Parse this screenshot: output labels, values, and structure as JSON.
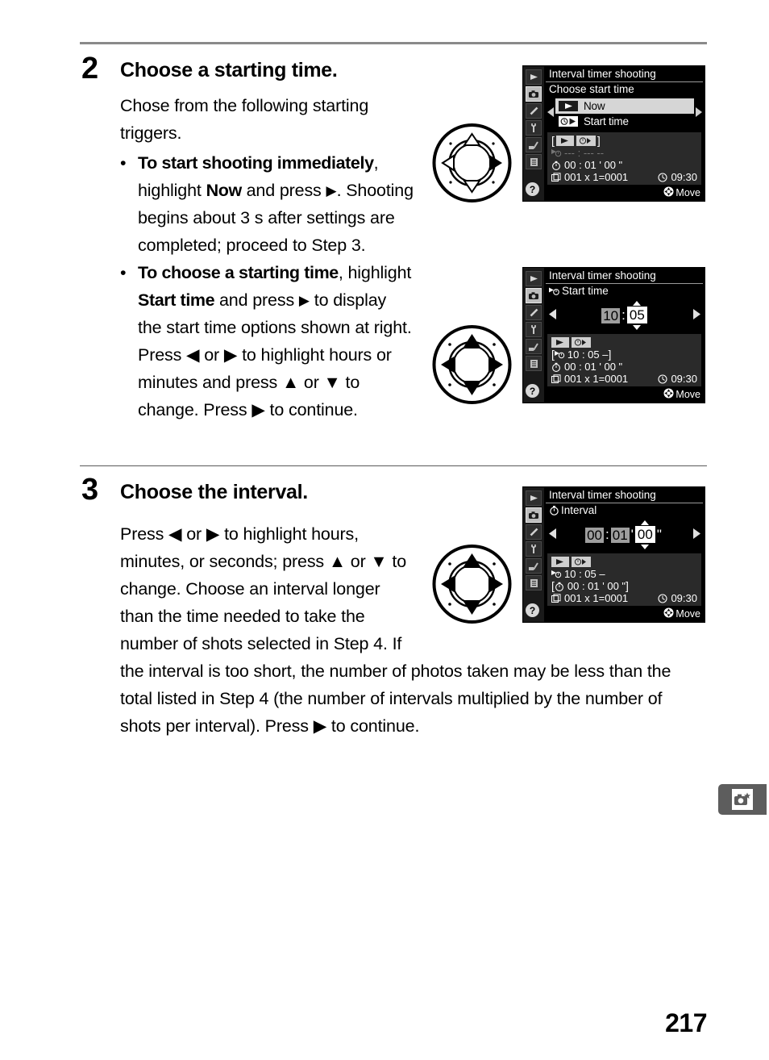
{
  "page": {
    "number": "217",
    "corner_tab_icon": "shooting-menu-camera-star-icon"
  },
  "steps": [
    {
      "number": "2",
      "title": "Choose a starting time.",
      "intro": "Chose from the following starting triggers.",
      "bullets": [
        {
          "lead": "To start shooting immediately",
          "rest_a": ", highlight ",
          "strong_b": "Now",
          "rest_b": " and press ",
          "arrow": "▶",
          "rest_c": ".  Shooting begins about 3 s after settings are completed; proceed to Step 3."
        },
        {
          "lead": "To choose a starting time",
          "rest_a": ", highlight ",
          "strong_b": "Start time",
          "rest_b": " and press ",
          "arrow": "▶",
          "rest_c": " to display the start time options shown at right.  Press ◀ or ▶ to highlight hours or minutes and press ▲ or ▼ to change.  Press ▶ to continue."
        }
      ]
    },
    {
      "number": "3",
      "title": "Choose the interval.",
      "paragraph": "Press ◀ or ▶ to highlight hours, minutes, or seconds; press ▲ or ▼ to change.  Choose an interval longer than the time needed to take the number of shots selected in Step 4.  If the interval is too short, the number of photos taken may be less than the total listed in Step 4 (the number of intervals multiplied by the number of shots per interval).  Press ▶ to continue."
    }
  ],
  "multiselectors": [
    {
      "name": "multi-selector-right-only",
      "active": [
        "right"
      ]
    },
    {
      "name": "multi-selector-all-directions",
      "active": [
        "up",
        "down",
        "left",
        "right"
      ]
    },
    {
      "name": "multi-selector-all-directions",
      "active": [
        "up",
        "down",
        "left",
        "right"
      ]
    }
  ],
  "lcd_screens": [
    {
      "id": "choose-start-time",
      "title": "Interval timer shooting",
      "subtitle": "Choose start time",
      "subtitle_icon": "",
      "menu": [
        {
          "icon": "play-icon",
          "label": "Now",
          "highlighted": true
        },
        {
          "icon": "clock-play-icon",
          "label": "Start time",
          "highlighted": false
        }
      ],
      "left_chevron": "◀",
      "right_chevron": "▶",
      "status": {
        "mode_chips": [
          "play-icon",
          "clock-play-icon"
        ],
        "bracket_open": "[",
        "bracket_close": "]",
        "start_time_icon": "start-time-icon",
        "start_time_value": "--- : --- --",
        "start_time_dim": true,
        "interval_icon": "interval-clock-icon",
        "interval_value": "00 : 01 ' 00 \"",
        "interval_bracketed": false,
        "shots_icon": "frames-icon",
        "shots_value": "001 x 1=0001",
        "clock_icon": "clock-icon",
        "clock_value": "09:30"
      },
      "footer_icon": "multi-selector-icon",
      "footer_label": "Move"
    },
    {
      "id": "start-time-editor",
      "title": "Interval timer shooting",
      "subtitle": "Start time",
      "subtitle_icon": "start-time-icon",
      "editor": {
        "left_arrow": "◀",
        "right_arrow": "▶",
        "fields": [
          {
            "value": "10",
            "state": "gray"
          },
          {
            "sep": ":"
          },
          {
            "value": "05",
            "state": "selected"
          }
        ]
      },
      "status": {
        "mode_chips": [
          "play-icon",
          "clock-play-icon"
        ],
        "bracket_open": "[",
        "bracket_close": "]",
        "start_time_icon": "start-time-icon",
        "start_time_value": "10 : 05  –",
        "start_time_dim": false,
        "start_time_bracketed": true,
        "interval_icon": "interval-clock-icon",
        "interval_value": "00 : 01 ' 00 \"",
        "interval_bracketed": false,
        "shots_icon": "frames-icon",
        "shots_value": "001 x 1=0001",
        "clock_icon": "clock-icon",
        "clock_value": "09:30"
      },
      "footer_icon": "multi-selector-icon",
      "footer_label": "Move"
    },
    {
      "id": "interval-editor",
      "title": "Interval timer shooting",
      "subtitle": "Interval",
      "subtitle_icon": "interval-clock-icon",
      "editor": {
        "left_arrow": "◀",
        "right_arrow": "▶",
        "fields": [
          {
            "value": "00",
            "state": "gray"
          },
          {
            "sep": ":"
          },
          {
            "value": "01",
            "state": "gray"
          },
          {
            "sep": "'"
          },
          {
            "value": "00",
            "state": "selected"
          },
          {
            "sep": "\""
          }
        ]
      },
      "status": {
        "mode_chips": [
          "play-icon",
          "clock-play-icon"
        ],
        "bracket_open": "[",
        "bracket_close": "]",
        "start_time_icon": "start-time-icon",
        "start_time_value": "10 : 05  –",
        "start_time_dim": false,
        "start_time_bracketed": false,
        "interval_icon": "interval-clock-icon",
        "interval_value": "00 : 01 ' 00 \"",
        "interval_bracketed": true,
        "shots_icon": "frames-icon",
        "shots_value": "001 x 1=0001",
        "clock_icon": "clock-icon",
        "clock_value": "09:30"
      },
      "footer_icon": "multi-selector-icon",
      "footer_label": "Move"
    }
  ],
  "lcd_sidebar_icons": [
    "playback-icon",
    "shooting-menu-icon",
    "custom-settings-pencil-icon",
    "setup-wrench-icon",
    "retouch-brush-icon",
    "recent-settings-icon",
    "help-question-icon"
  ]
}
